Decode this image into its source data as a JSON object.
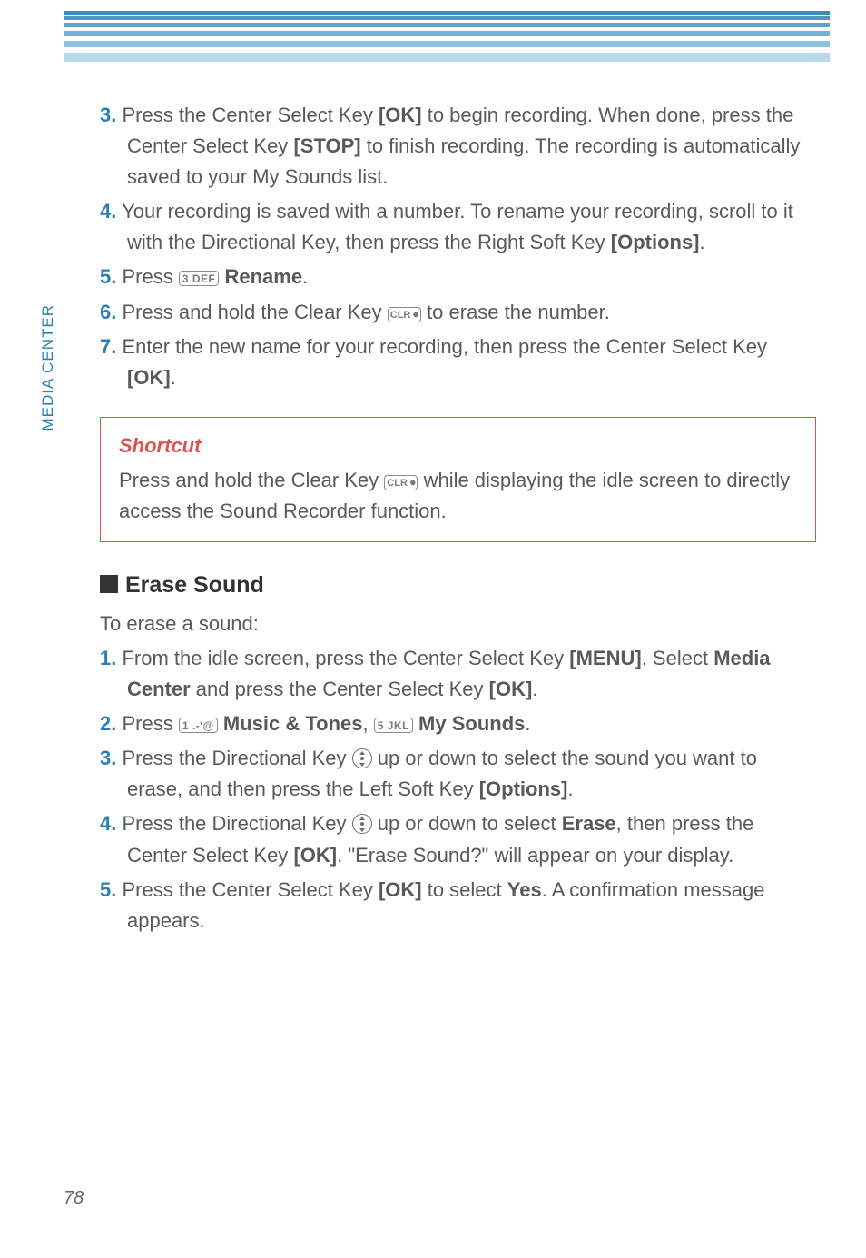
{
  "sideTab": "MEDIA CENTER",
  "pageNumber": "78",
  "keys": {
    "key3": "3 DEF",
    "key1": "1 .-'@",
    "key5": "5 JKL",
    "clr": "CLR ⏺"
  },
  "topSteps": [
    {
      "n": "3.",
      "pre": "Press the Center Select Key ",
      "b1": "[OK]",
      "mid": " to begin recording. When done, press the Center Select Key ",
      "b2": "[STOP]",
      "post": " to finish recording. The recording is automatically saved to your My Sounds list."
    },
    {
      "n": "4.",
      "pre": "Your recording is saved with a number. To rename your recording, scroll to it with the Directional Key, then press the Right Soft Key ",
      "b1": "[Options]",
      "post": "."
    },
    {
      "n": "5.",
      "pre": "Press ",
      "iconKey": "key3",
      "post2pre": " ",
      "b1": "Rename",
      "post": "."
    },
    {
      "n": "6.",
      "pre": "Press and hold the Clear Key ",
      "iconClr": true,
      "post": " to erase the number."
    },
    {
      "n": "7.",
      "pre": "Enter the new name for your recording, then press the Center Select Key ",
      "b1": "[OK]",
      "post": "."
    }
  ],
  "shortcut": {
    "title": "Shortcut",
    "pre": "Press and hold the Clear Key ",
    "post": " while displaying the idle screen to directly access the Sound Recorder function."
  },
  "section": {
    "title": "Erase Sound",
    "intro": "To erase a sound:"
  },
  "eraseSteps": {
    "s1": {
      "n": "1.",
      "pre": "From the idle screen, press the Center Select Key ",
      "b1": "[MENU]",
      "mid": ". Select ",
      "b2": "Media Center",
      "mid2": " and press the Center Select Key ",
      "b3": "[OK]",
      "post": "."
    },
    "s2": {
      "n": "2.",
      "pre": "Press ",
      "b1": "Music & Tones",
      "mid": ", ",
      "b2": "My Sounds",
      "post": "."
    },
    "s3": {
      "n": "3.",
      "pre": "Press the Directional Key ",
      "mid": " up or down to select the sound you want to erase, and then press the Left Soft Key ",
      "b1": "[Options]",
      "post": "."
    },
    "s4": {
      "n": "4.",
      "pre": "Press the Directional Key ",
      "mid": " up or down to select ",
      "b1": "Erase",
      "mid2": ", then press the Center Select Key ",
      "b2": "[OK]",
      "post": ". \"Erase Sound?\" will appear on your display."
    },
    "s5": {
      "n": "5.",
      "pre": "Press the Center Select Key ",
      "b1": "[OK]",
      "mid": " to select ",
      "b2": "Yes",
      "post": ". A confirmation message appears."
    }
  }
}
